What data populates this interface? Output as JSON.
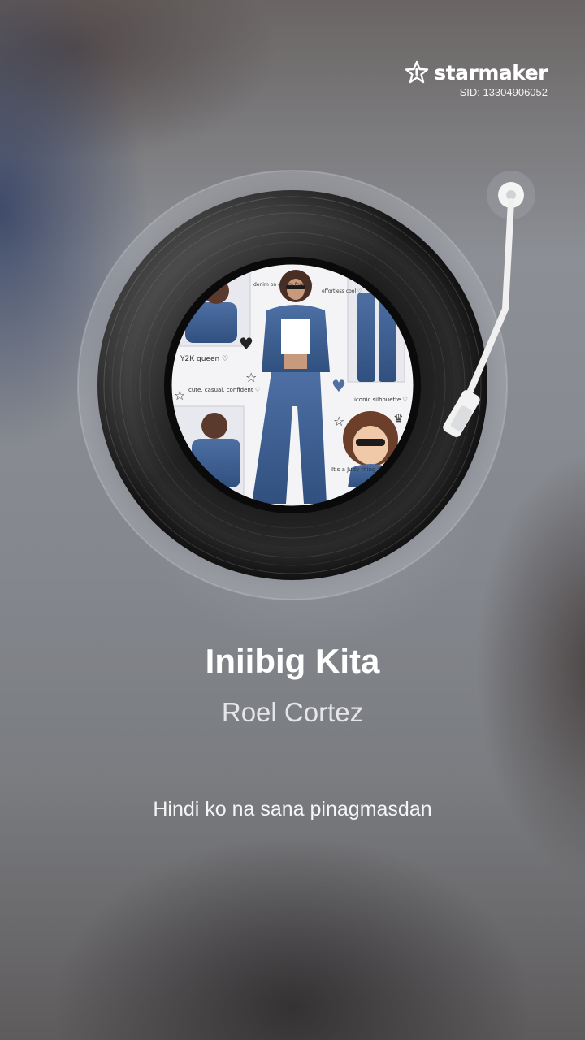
{
  "brand": {
    "name": "starmaker",
    "sid": "SID: 13304906052",
    "icon": "star-logo-icon"
  },
  "cover": {
    "captions": [
      "Y2K queen ♡",
      "cute, casual, confident ♡",
      "iconic silhouette ♡",
      "It's a Judy thing ♡",
      "effortless cool ♡",
      "denim on denim forever"
    ]
  },
  "song": {
    "title": "Iniibig Kita",
    "artist": "Roel Cortez",
    "lyric": "Hindi ko na sana pinagmasdan"
  },
  "colors": {
    "record": "#0d0d0d",
    "text": "#ffffff",
    "denim": "#3f5f93"
  }
}
